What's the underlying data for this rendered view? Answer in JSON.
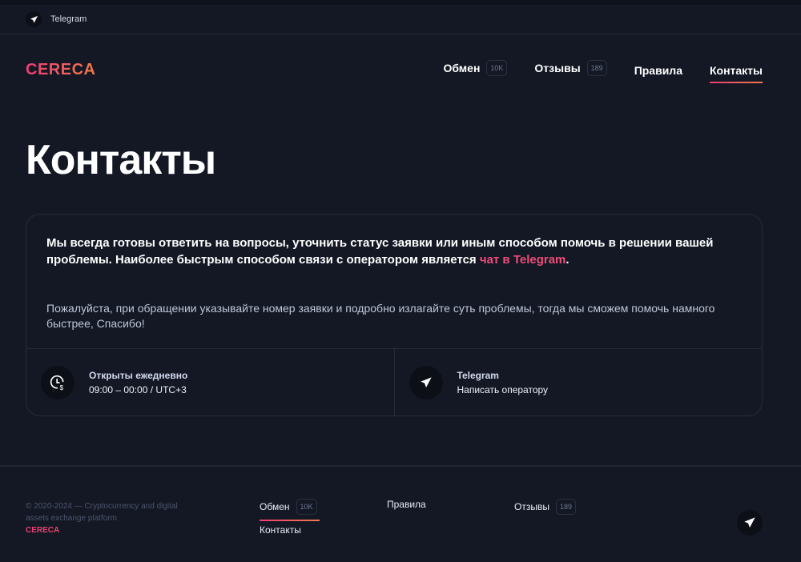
{
  "topbar": {
    "telegram_label": "Telegram"
  },
  "header": {
    "logo": "CERECA",
    "nav": [
      {
        "label": "Обмен",
        "badge": "10K"
      },
      {
        "label": "Отзывы",
        "badge": "189"
      },
      {
        "label": "Правила"
      },
      {
        "label": "Контакты"
      }
    ]
  },
  "page_title": "Контакты",
  "card": {
    "intro_text": "Мы всегда готовы ответить на вопросы, уточнить статус заявки или иным способом помочь в решении вашей проблемы. Наиболее быстрым способом связи с оператором является ",
    "intro_link": "чат в Telegram",
    "intro_end": ".",
    "note": "Пожалуйста, при обращении указывайте номер заявки и подробно излагайте суть проблемы, тогда мы сможем помочь намного быстрее, Спасибо!",
    "hours_title": "Открыты ежедневно",
    "hours_value": "09:00 – 00:00 / UTC+3",
    "tg_title": "Telegram",
    "tg_value": "Написать оператору"
  },
  "footer": {
    "copyright": "© 2020-2024 — Cryptocurrency and digital assets exchange platform",
    "brand": "CERECA",
    "links": [
      {
        "label": "Обмен",
        "badge": "10K"
      },
      {
        "label": "Правила"
      },
      {
        "label": "Отзывы",
        "badge": "189"
      },
      {
        "label": "Контакты"
      }
    ]
  }
}
